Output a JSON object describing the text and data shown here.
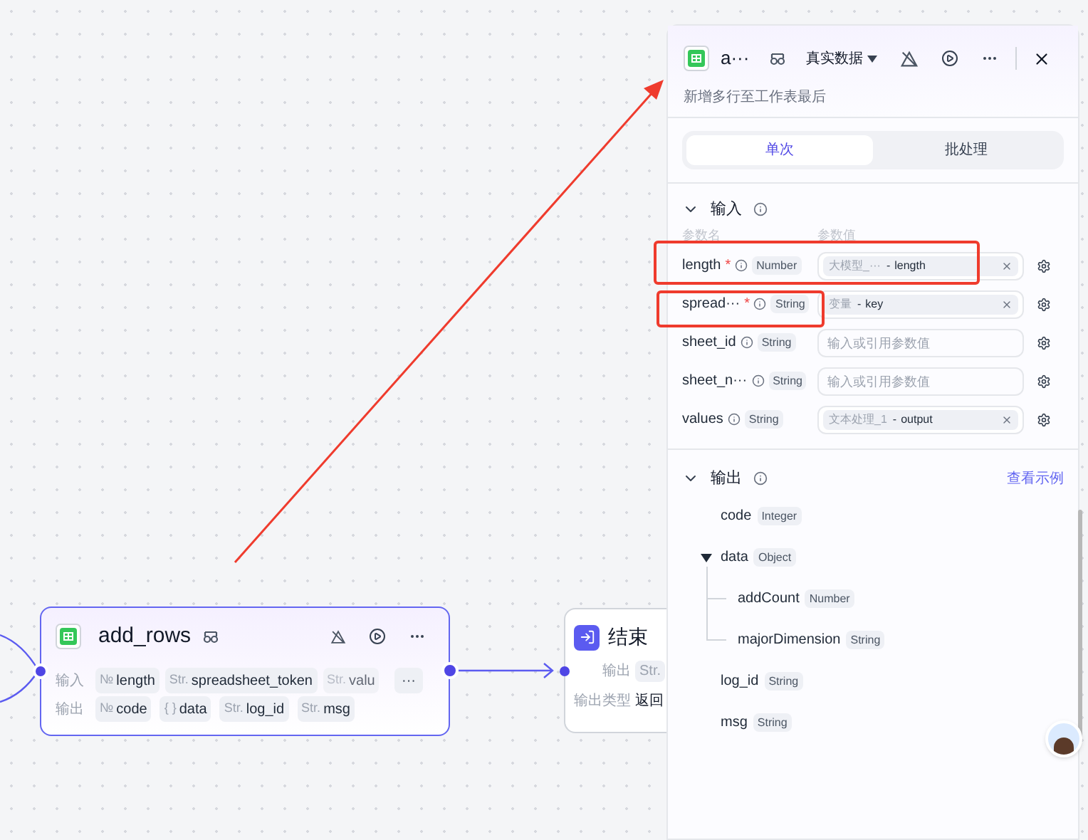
{
  "canvas": {
    "nodes": [
      {
        "kind": "action",
        "title": "add_rows",
        "input_label": "输入",
        "inputs": [
          {
            "prefix": "№",
            "name": "length"
          },
          {
            "prefix": "Str.",
            "name": "spreadsheet_token"
          },
          {
            "prefix": "Str.",
            "name": "valu"
          }
        ],
        "more": "···",
        "output_label": "输出",
        "outputs": [
          {
            "prefix": "№",
            "name": "code"
          },
          {
            "prefix": "{ }",
            "name": "data"
          },
          {
            "prefix": "Str.",
            "name": "log_id"
          },
          {
            "prefix": "Str.",
            "name": "msg"
          }
        ]
      },
      {
        "kind": "end",
        "title": "结束",
        "rows": [
          {
            "label": "输出",
            "value": "Str."
          },
          {
            "label": "输出类型",
            "value": "返回"
          }
        ]
      }
    ]
  },
  "panel": {
    "title": "a···",
    "data_mode": "真实数据",
    "subtitle": "新增多行至工作表最后",
    "tabs": [
      {
        "label": "单次",
        "selected": true
      },
      {
        "label": "批处理",
        "selected": false
      }
    ],
    "input_section": {
      "title": "输入",
      "expanded": true,
      "column_1": "参数名",
      "column_2": "参数值",
      "params": [
        {
          "name": "length",
          "required_mark": "*",
          "type": "Number",
          "kind": "reference",
          "source": "大模型_···",
          "separator": "-",
          "variable": "length",
          "highlighted": true
        },
        {
          "name": "spread···",
          "required_mark": "*",
          "type": "String",
          "kind": "reference",
          "source": "变量",
          "separator": "-",
          "variable": "key",
          "highlighted": true
        },
        {
          "name": "sheet_id",
          "type": "String",
          "kind": "empty",
          "placeholder": "输入或引用参数值",
          "highlighted": false
        },
        {
          "name": "sheet_n···",
          "type": "String",
          "kind": "empty",
          "placeholder": "输入或引用参数值",
          "highlighted": false
        },
        {
          "name": "values",
          "type": "String",
          "kind": "reference",
          "source": "文本处理_1",
          "separator": "-",
          "variable": "output",
          "highlighted": false
        }
      ]
    },
    "output_section": {
      "title": "输出",
      "expanded": true,
      "link": "查看示例",
      "fields": [
        {
          "name": "code",
          "type": "Integer"
        },
        {
          "name": "data",
          "type": "Object",
          "expanded": true,
          "children": [
            {
              "name": "addCount",
              "type": "Number"
            },
            {
              "name": "majorDimension",
              "type": "String"
            }
          ]
        },
        {
          "name": "log_id",
          "type": "String"
        },
        {
          "name": "msg",
          "type": "String"
        }
      ]
    }
  }
}
